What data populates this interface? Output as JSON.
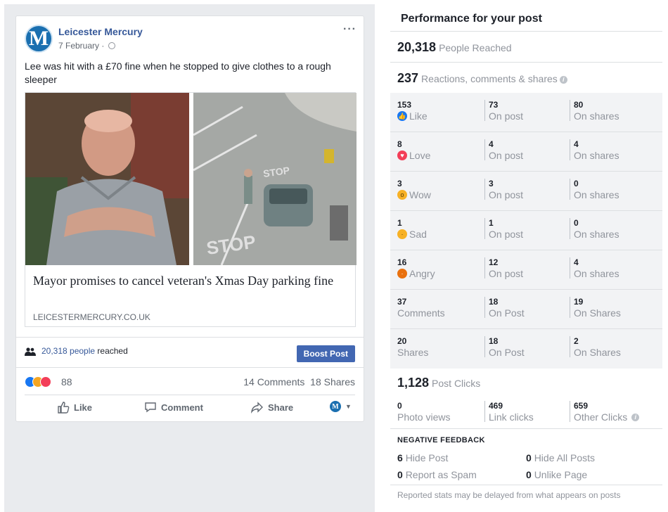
{
  "post": {
    "page_name": "Leicester Mercury",
    "avatar_letter": "M",
    "date": "7 February",
    "date_sep": "·",
    "more": "···",
    "text": "Lee was hit with a £70 fine when he stopped to give clothes to a rough sleeper",
    "link": {
      "title": "Mayor promises to cancel veteran's Xmas Day parking fine",
      "domain": "LEICESTERMERCURY.CO.UK"
    },
    "reach": {
      "count": "20,318 people",
      "suffix": " reached"
    },
    "boost_label": "Boost Post",
    "reactions_count": "88",
    "comments": "14 Comments",
    "shares": "18 Shares",
    "actions": {
      "like": "Like",
      "comment": "Comment",
      "share": "Share"
    }
  },
  "performance": {
    "title": "Performance for your post",
    "people_reached": {
      "value": "20,318",
      "label": "People Reached"
    },
    "engagement": {
      "value": "237",
      "label": "Reactions, comments & shares"
    },
    "rows": [
      {
        "value": "153",
        "label": "Like",
        "icon": "like-icon",
        "post": "73",
        "post_label": "On post",
        "shares": "80",
        "shares_label": "On shares"
      },
      {
        "value": "8",
        "label": "Love",
        "icon": "love-icon",
        "post": "4",
        "post_label": "On post",
        "shares": "4",
        "shares_label": "On shares"
      },
      {
        "value": "3",
        "label": "Wow",
        "icon": "wow-icon",
        "post": "3",
        "post_label": "On post",
        "shares": "0",
        "shares_label": "On shares"
      },
      {
        "value": "1",
        "label": "Sad",
        "icon": "sad-icon",
        "post": "1",
        "post_label": "On post",
        "shares": "0",
        "shares_label": "On shares"
      },
      {
        "value": "16",
        "label": "Angry",
        "icon": "angry-icon",
        "post": "12",
        "post_label": "On post",
        "shares": "4",
        "shares_label": "On shares"
      },
      {
        "value": "37",
        "label": "Comments",
        "icon": "",
        "post": "18",
        "post_label": "On Post",
        "shares": "19",
        "shares_label": "On Shares"
      },
      {
        "value": "20",
        "label": "Shares",
        "icon": "",
        "post": "18",
        "post_label": "On Post",
        "shares": "2",
        "shares_label": "On Shares"
      }
    ],
    "post_clicks": {
      "value": "1,128",
      "label": "Post Clicks"
    },
    "clicks": [
      {
        "value": "0",
        "label": "Photo views"
      },
      {
        "value": "469",
        "label": "Link clicks"
      },
      {
        "value": "659",
        "label": "Other Clicks"
      }
    ],
    "negative": {
      "title": "NEGATIVE FEEDBACK",
      "hide_post": {
        "value": "6",
        "label": "Hide Post"
      },
      "hide_all": {
        "value": "0",
        "label": "Hide All Posts"
      },
      "spam": {
        "value": "0",
        "label": "Report as Spam"
      },
      "unlike": {
        "value": "0",
        "label": "Unlike Page"
      }
    },
    "footnote": "Reported stats may be delayed from what appears on posts"
  },
  "colors": {
    "link": "#365899",
    "boost": "#4267b2",
    "muted": "#90949c",
    "like": "#1877f2",
    "love": "#f33e58",
    "angry": "#e9710f",
    "wow": "#f7b125"
  }
}
